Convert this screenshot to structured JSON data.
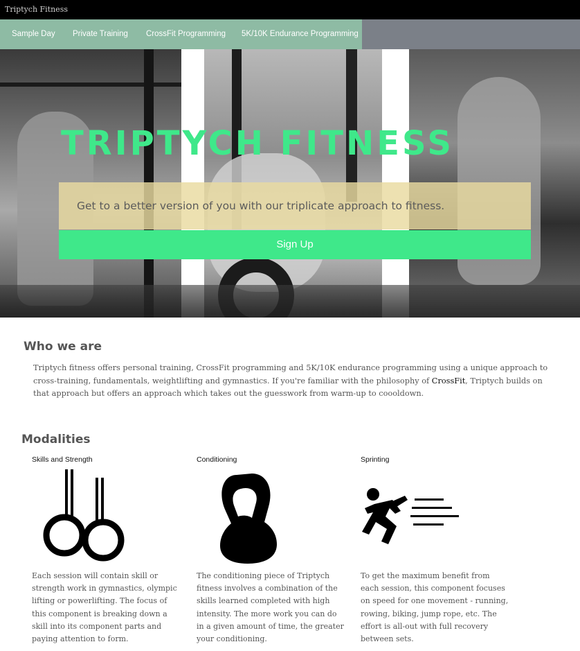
{
  "window": {
    "title": "Triptych Fitness"
  },
  "nav": {
    "items": [
      "Sample Day",
      "Private Training",
      "CrossFit Programming",
      "5K/10K Endurance Programming"
    ]
  },
  "hero": {
    "title": "Triptych Fitness",
    "tagline": "Get to a better version of you with our triplicate approach to fitness.",
    "cta_label": "Sign Up"
  },
  "who": {
    "title": "Who we are",
    "body_before": "Triptych fitness offers personal training, CrossFit programming and 5K/10K endurance programming using a unique approach to cross-training, fundamentals, weightlifting and gymnastics. If you're familiar with the philosophy of ",
    "link": "CrossFit",
    "body_after": ", Triptych builds on that approach but offers an approach which takes out the guesswork from warm-up to coooldown."
  },
  "modalities": {
    "title": "Modalities",
    "items": [
      {
        "label": "Skills and Strength",
        "icon": "gymnastic-rings-icon",
        "text": "Each session will contain skill or strength work in gymnastics, olympic lifting or powerlifting. The focus of this component is breaking down a skill into its component parts and paying attention to form."
      },
      {
        "label": "Conditioning",
        "icon": "kettlebell-icon",
        "text": "The conditioning piece of Triptych fitness involves a combination of the skills learned completed with high intensity. The more work you can do in a given amount of time, the greater your conditioning."
      },
      {
        "label": "Sprinting",
        "icon": "sprinter-icon",
        "text": "To get the maximum benefit from each session, this component focuses on speed for one movement - running, rowing, biking, jump rope, etc. The effort is all-out with full recovery between sets."
      }
    ]
  },
  "colors": {
    "accent": "#3fe88a",
    "nav_green": "#8ebba4",
    "nav_gray": "#7b8088",
    "tagline_bg": "#e9dba0"
  }
}
